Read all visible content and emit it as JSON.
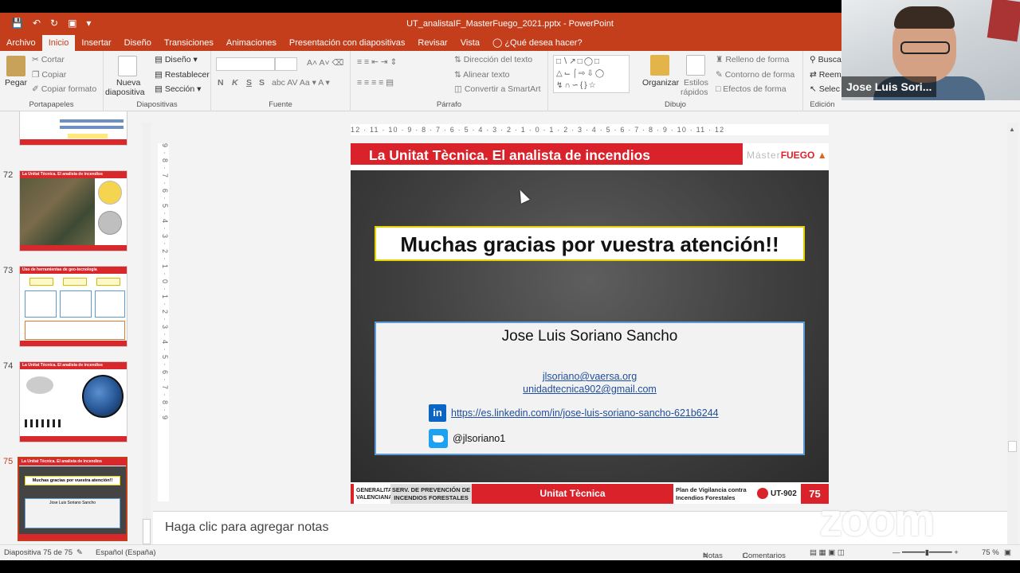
{
  "window": {
    "title": "UT_analistaIF_MasterFuego_2021.pptx - PowerPoint"
  },
  "tabs": [
    {
      "label": "Archivo"
    },
    {
      "label": "Inicio"
    },
    {
      "label": "Insertar"
    },
    {
      "label": "Diseño"
    },
    {
      "label": "Transiciones"
    },
    {
      "label": "Animaciones"
    },
    {
      "label": "Presentación con diapositivas"
    },
    {
      "label": "Revisar"
    },
    {
      "label": "Vista"
    },
    {
      "label": "¿Qué desea hacer?"
    }
  ],
  "ribbon": {
    "portapapeles": {
      "pegar": "Pegar",
      "cortar": "Cortar",
      "copiar": "Copiar",
      "copiar_formato": "Copiar formato",
      "label": "Portapapeles"
    },
    "diapositivas": {
      "nueva_line1": "Nueva",
      "nueva_line2": "diapositiva",
      "diseno": "Diseño",
      "restablecer": "Restablecer",
      "seccion": "Sección",
      "label": "Diapositivas"
    },
    "fuente": {
      "label": "Fuente",
      "bold": "N",
      "italic": "K",
      "underline": "S",
      "strike": "S"
    },
    "parrafo": {
      "direccion": "Dirección del texto",
      "alinear": "Alinear texto",
      "smartart": "Convertir a SmartArt",
      "label": "Párrafo"
    },
    "dibujo": {
      "organizar": "Organizar",
      "estilos_line1": "Estilos",
      "estilos_line2": "rápidos",
      "relleno": "Relleno de forma",
      "contorno": "Contorno de forma",
      "efectos": "Efectos de forma",
      "label": "Dibujo"
    },
    "edicion": {
      "buscar": "Busca",
      "reemplazar": "Reem",
      "seleccionar": "Selec",
      "label": "Edición"
    }
  },
  "thumbnails": [
    {
      "num": "72"
    },
    {
      "num": "73"
    },
    {
      "num": "74"
    },
    {
      "num": "75"
    }
  ],
  "thumb_content": {
    "header_72": "La Unitat Tècnica. El analista de incendios",
    "header_73": "Uso de herramientas de geo-tecnología",
    "header_74": "La Unitat Tècnica. El analista de incendios",
    "header_75": "La Unitat Tècnica. El analista de incendios",
    "thanks_75": "Muchas gracias por vuestra atención!!",
    "name_75": "Jose Luis Soriano Sancho"
  },
  "rulers": {
    "horizontal": "12 · 11 · 10 · 9 · 8 · 7 · 6 · 5 · 4 · 3 · 2 · 1 · 0 · 1 · 2 · 3 · 4 · 5 · 6 · 7 · 8 · 9 · 10 · 11 · 12",
    "vertical": "9 · 8 · 7 · 6 · 5 · 4 · 3 · 2 · 1 · 0 · 1 · 2 · 3 · 4 · 5 · 6 · 7 · 8 · 9"
  },
  "slide": {
    "header": "La Unitat Tècnica. El analista de incendios",
    "logo_master": "Máster",
    "logo_fuego": "FUEGO",
    "thanks": "Muchas gracias por vuestra atención!!",
    "name": "Jose Luis Soriano Sancho",
    "email1": "jlsoriano@vaersa.org",
    "email2": "unidadtecnica902@gmail.com",
    "linkedin_icon": "in",
    "linkedin": "https://es.linkedin.com/in/jose-luis-soriano-sancho-621b6244",
    "twitter": "@jlsoriano1",
    "footer": {
      "gv": "GENERALITAT VALENCIANA",
      "serv": "SERV. DE PREVENCIÓN DE INCENDIOS FORESTALES",
      "ut": "Unitat Tècnica",
      "plan": "Plan de Vigilancia contra Incendios Forestales",
      "logo": "UT-902",
      "num": "75"
    }
  },
  "notes": {
    "placeholder": "Haga clic para agregar notas"
  },
  "status": {
    "slide": "Diapositiva 75 de 75",
    "lang": "Español (España)",
    "notas": "Notas",
    "comentarios": "Comentarios",
    "zoom": "75 %"
  },
  "video": {
    "name": "Jose Luis Sori..."
  },
  "zoom_logo": "zoom",
  "colors": {
    "accent": "#c43e1c",
    "slide_red": "#d9222a",
    "link": "#1f4e9e"
  }
}
